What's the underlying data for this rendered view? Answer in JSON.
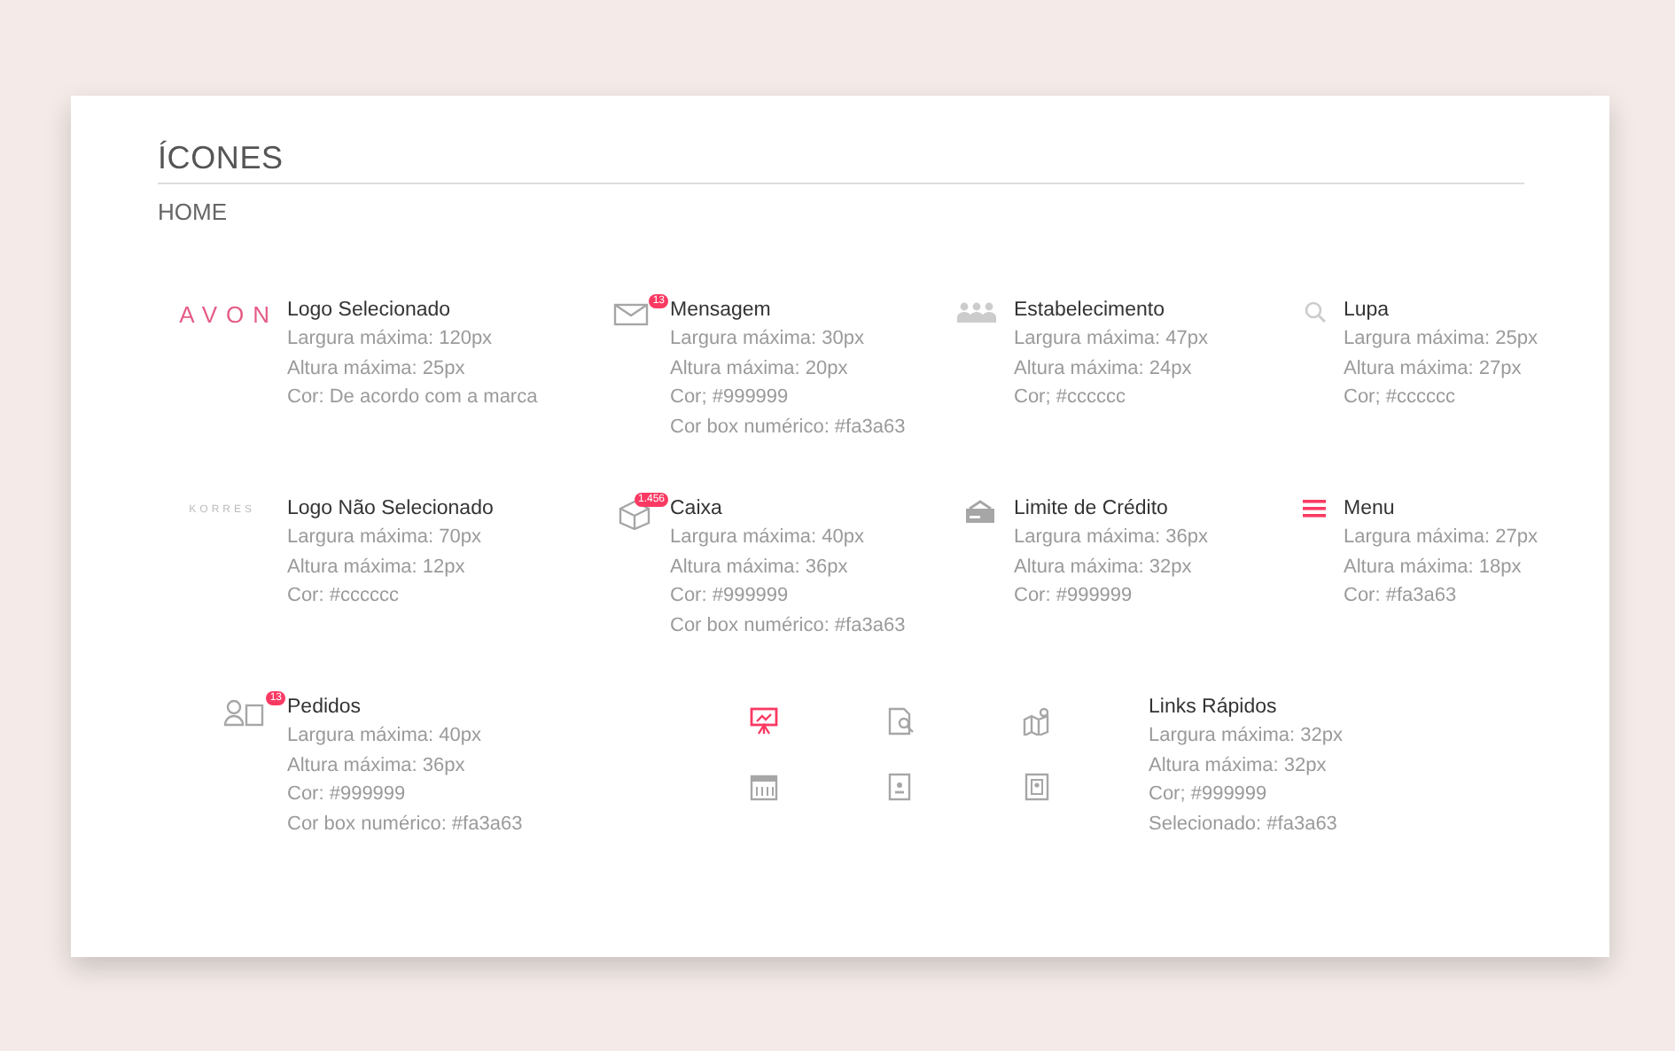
{
  "title": "ÍCONES",
  "section": "HOME",
  "rows": [
    {
      "specs": [
        {
          "kind": "logo",
          "logo": "AVON",
          "selected": true,
          "name": "Logo Selecionado",
          "lines": [
            "Largura máxima: 120px",
            "Altura máxima: 25px",
            "Cor: De acordo com a marca"
          ]
        },
        {
          "kind": "icon",
          "badge": "13",
          "name": "Mensagem",
          "lines": [
            "Largura máxima: 30px",
            "Altura máxima: 20px",
            "Cor; #999999",
            "Cor box numérico: #fa3a63"
          ]
        },
        {
          "kind": "icon",
          "name": "Estabelecimento",
          "lines": [
            "Largura máxima: 47px",
            "Altura máxima: 24px",
            "Cor; #cccccc"
          ]
        },
        {
          "kind": "icon",
          "name": "Lupa",
          "lines": [
            "Largura máxima: 25px",
            "Altura máxima: 27px",
            "Cor; #cccccc"
          ]
        }
      ]
    },
    {
      "specs": [
        {
          "kind": "logo",
          "logo": "KORRES",
          "selected": false,
          "name": "Logo Não Selecionado",
          "lines": [
            "Largura máxima: 70px",
            "Altura máxima: 12px",
            "Cor: #cccccc"
          ]
        },
        {
          "kind": "icon",
          "badge": "1.456",
          "name": "Caixa",
          "lines": [
            "Largura máxima: 40px",
            "Altura máxima: 36px",
            "Cor: #999999",
            "Cor box numérico: #fa3a63"
          ]
        },
        {
          "kind": "icon",
          "name": "Limite de Crédito",
          "lines": [
            "Largura máxima: 36px",
            "Altura máxima: 32px",
            "Cor: #999999"
          ]
        },
        {
          "kind": "icon",
          "name": "Menu",
          "lines": [
            "Largura máxima: 27px",
            "Altura máxima: 18px",
            "Cor: #fa3a63"
          ]
        }
      ]
    }
  ],
  "orders": {
    "badge": "13",
    "name": "Pedidos",
    "lines": [
      "Largura máxima: 40px",
      "Altura máxima: 36px",
      "Cor: #999999",
      "Cor box numérico: #fa3a63"
    ]
  },
  "quick_links": [
    {
      "selected": true
    },
    {
      "selected": false
    },
    {
      "selected": false
    },
    {
      "selected": false
    },
    {
      "selected": false
    },
    {
      "selected": false
    }
  ],
  "quick_links_spec": {
    "name": "Links Rápidos",
    "lines": [
      "Largura máxima: 32px",
      "Altura máxima: 32px",
      "Cor; #999999",
      "Selecionado: #fa3a63"
    ]
  }
}
